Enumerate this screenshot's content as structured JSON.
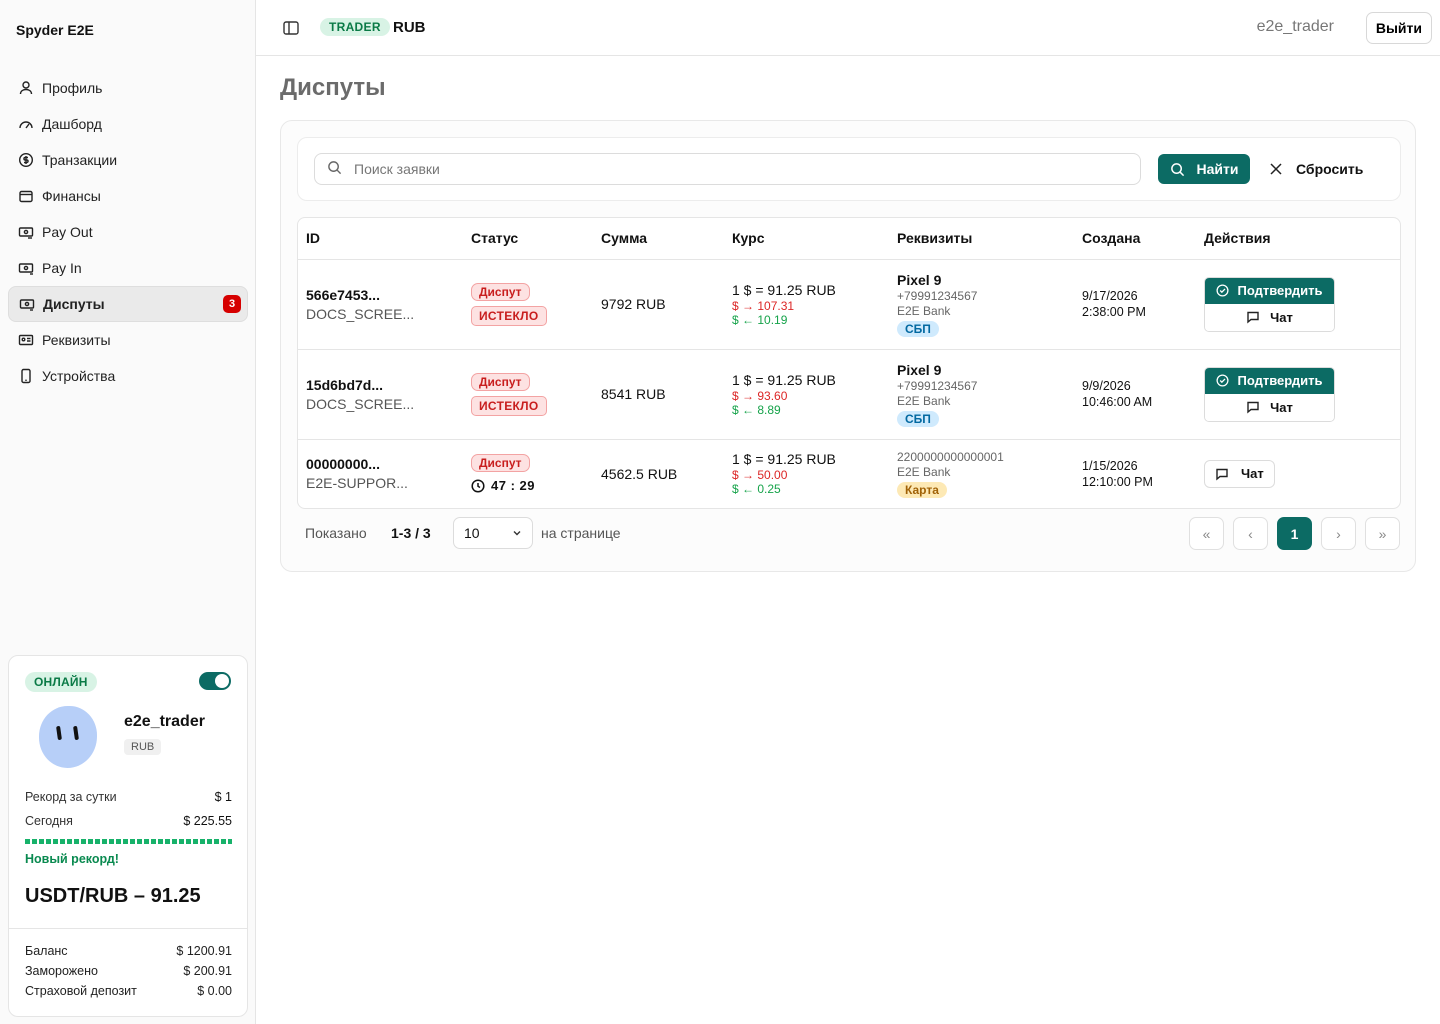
{
  "sidebar": {
    "brand": "Spyder E2E",
    "items": [
      {
        "label": "Профиль",
        "icon": "user-icon"
      },
      {
        "label": "Дашборд",
        "icon": "gauge-icon"
      },
      {
        "label": "Транзакции",
        "icon": "dollar-circle-icon"
      },
      {
        "label": "Финансы",
        "icon": "wallet-icon"
      },
      {
        "label": "Pay Out",
        "icon": "payout-icon"
      },
      {
        "label": "Pay In",
        "icon": "payin-icon"
      },
      {
        "label": "Диспуты",
        "icon": "dispute-icon",
        "badge": "3",
        "active": true
      },
      {
        "label": "Реквизиты",
        "icon": "id-card-icon"
      },
      {
        "label": "Устройства",
        "icon": "smartphone-icon"
      }
    ],
    "user_card": {
      "status": "ОНЛАЙН",
      "username": "e2e_trader",
      "currency": "RUB",
      "record_label": "Рекорд за сутки",
      "record_value": "$ 1",
      "today_label": "Сегодня",
      "today_value": "$ 225.55",
      "progress": 1.0,
      "new_record": "Новый рекорд!",
      "rate": "USDT/RUB – 91.25",
      "balance_label": "Баланс",
      "balance_value": "$ 1200.91",
      "frozen_label": "Заморожено",
      "frozen_value": "$ 200.91",
      "deposit_label": "Страховой депозит",
      "deposit_value": "$ 0.00"
    }
  },
  "header": {
    "role": "TRADER",
    "currency": "RUB",
    "username": "e2e_trader",
    "logout": "Выйти"
  },
  "main": {
    "title": "Диспуты",
    "search": {
      "placeholder": "Поиск заявки",
      "find_label": "Найти",
      "reset_label": "Сбросить"
    },
    "table": {
      "headers": [
        "ID",
        "Статус",
        "Сумма",
        "Курс",
        "Реквизиты",
        "Создана",
        "Действия"
      ],
      "rows": [
        {
          "id": "566e7453...",
          "sub": "DOCS_SCREE...",
          "status": "Диспут",
          "status2": "ИСТЕКЛО",
          "amount": "9792 RUB",
          "rate": "1 $ = 91.25 RUB",
          "rate_out": "$ → 107.31",
          "rate_in": "$ ← 10.19",
          "req_title": "Pixel 9",
          "req_phone": "+79991234567",
          "req_bank": "E2E Bank",
          "req_badge": "СБП",
          "created_date": "9/17/2026",
          "created_time": "2:38:00 PM",
          "confirm": "Подтвердить",
          "chat": "Чат"
        },
        {
          "id": "15d6bd7d...",
          "sub": "DOCS_SCREE...",
          "status": "Диспут",
          "status2": "ИСТЕКЛО",
          "amount": "8541 RUB",
          "rate": "1 $ = 91.25 RUB",
          "rate_out": "$ → 93.60",
          "rate_in": "$ ← 8.89",
          "req_title": "Pixel 9",
          "req_phone": "+79991234567",
          "req_bank": "E2E Bank",
          "req_badge": "СБП",
          "created_date": "9/9/2026",
          "created_time": "10:46:00 AM",
          "confirm": "Подтвердить",
          "chat": "Чат"
        },
        {
          "id": "00000000...",
          "sub": "E2E-SUPPOR...",
          "status": "Диспут",
          "timer": "47 : 29",
          "amount": "4562.5 RUB",
          "rate": "1 $ = 91.25 RUB",
          "rate_out": "$ → 50.00",
          "rate_in": "$ ← 0.25",
          "req_card": "2200000000000001",
          "req_bank": "E2E Bank",
          "req_badge": "Карта",
          "created_date": "1/15/2026",
          "created_time": "12:10:00 PM",
          "chat": "Чат"
        }
      ]
    },
    "pagination": {
      "shown_label": "Показано",
      "count": "1-3 / 3",
      "per_page": "10",
      "per_page_label": "на странице",
      "current_page": "1",
      "first": "«",
      "prev": "‹",
      "next": "›",
      "last": "»"
    }
  },
  "colors": {
    "accent": "#0c6b64",
    "danger": "#c81e1e",
    "success": "#16a34a"
  }
}
